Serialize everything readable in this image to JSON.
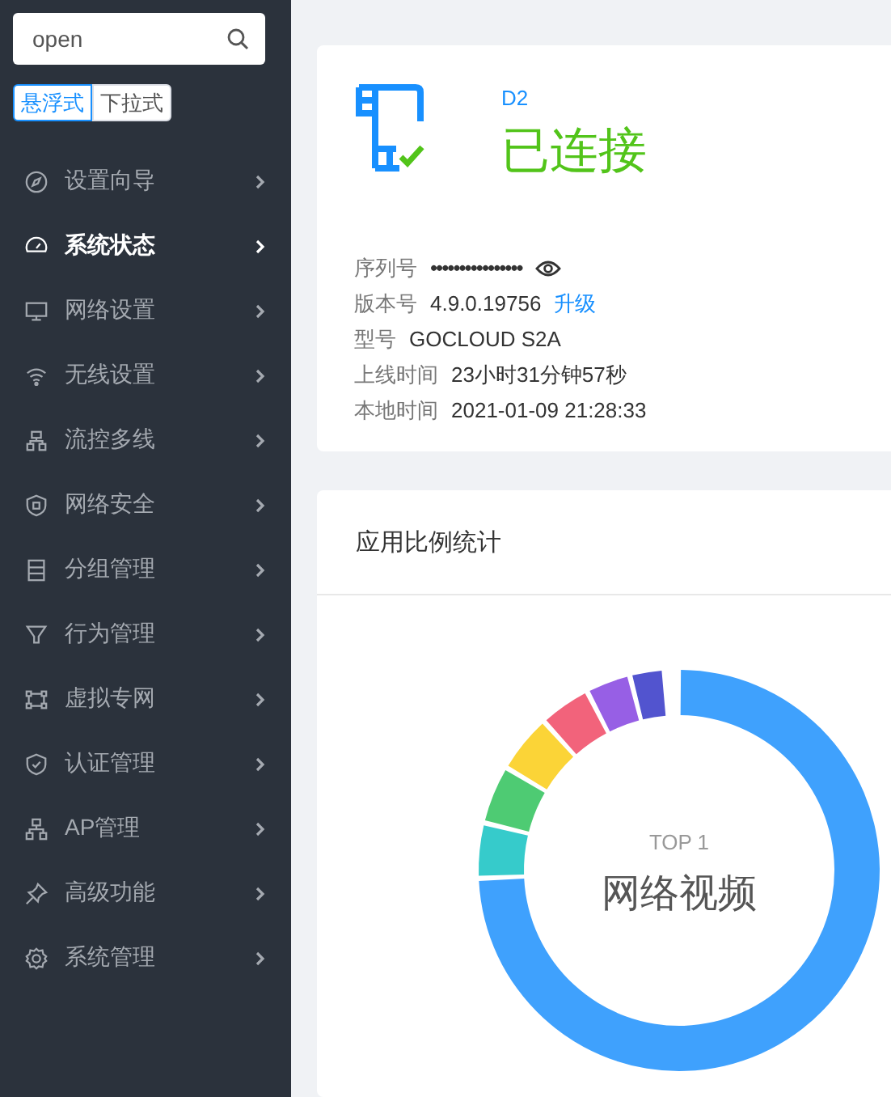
{
  "search": {
    "value": "open"
  },
  "mode_toggle": [
    {
      "label": "悬浮式",
      "selected": true
    },
    {
      "label": "下拉式",
      "selected": false
    }
  ],
  "menu": [
    {
      "label": "设置向导",
      "selected": false
    },
    {
      "label": "系统状态",
      "selected": true
    },
    {
      "label": "网络设置",
      "selected": false
    },
    {
      "label": "无线设置",
      "selected": false
    },
    {
      "label": "流控多线",
      "selected": false
    },
    {
      "label": "网络安全",
      "selected": false
    },
    {
      "label": "分组管理",
      "selected": false
    },
    {
      "label": "行为管理",
      "selected": false
    },
    {
      "label": "虚拟专网",
      "selected": false
    },
    {
      "label": "认证管理",
      "selected": false
    },
    {
      "label": "AP管理",
      "selected": false
    },
    {
      "label": "高级功能",
      "selected": false
    },
    {
      "label": "系统管理",
      "selected": false
    }
  ],
  "device": {
    "name": "D2",
    "status": "已连接",
    "connected": true,
    "info": [
      {
        "label": "序列号",
        "value": "••••••••••••••••",
        "kind": "masked"
      },
      {
        "label": "版本号",
        "value": "4.9.0.19756",
        "link": "升级",
        "kind": "version"
      },
      {
        "label": "型号",
        "value": "GOCLOUD S2A",
        "kind": "text"
      },
      {
        "label": "上线时间",
        "value": "23小时31分钟57秒",
        "kind": "text"
      },
      {
        "label": "本地时间",
        "value": "2021-01-09 21:28:33",
        "kind": "text"
      }
    ]
  },
  "app_stats": {
    "title": "应用比例统计",
    "center_caption": "TOP 1",
    "center_label": "网络视频"
  }
}
